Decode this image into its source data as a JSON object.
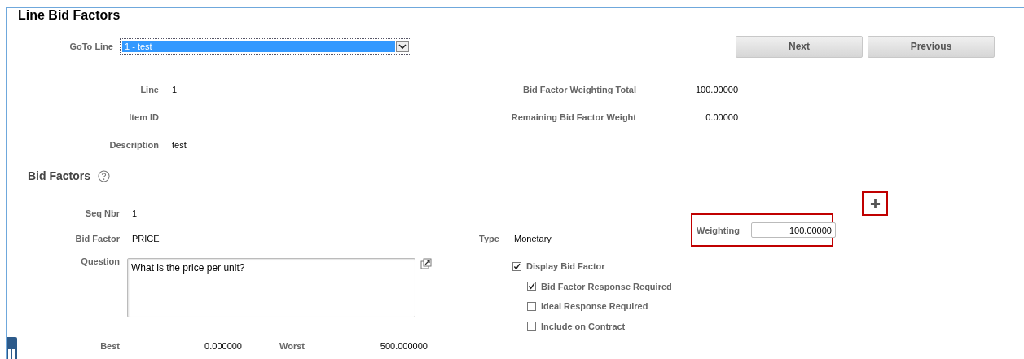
{
  "title": "Line Bid Factors",
  "goto": {
    "label": "GoTo Line",
    "value": "1 - test"
  },
  "buttons": [
    "Next",
    "Previous"
  ],
  "line_info": [
    {
      "label": "Line",
      "value": "1"
    },
    {
      "label": "Item ID"
    },
    {
      "label": "Description",
      "value": "test"
    }
  ],
  "totals": [
    {
      "label": "Bid Factor Weighting Total",
      "value": "100.00000"
    },
    {
      "label": "Remaining Bid Factor Weight",
      "value": "0.00000"
    }
  ],
  "bid_factors": {
    "heading": "Bid Factors",
    "seq_nbr": {
      "label": "Seq Nbr",
      "value": "1"
    },
    "bid_factor": {
      "label": "Bid Factor",
      "value": "PRICE"
    },
    "type": {
      "label": "Type",
      "value": "Monetary"
    },
    "weighting": {
      "label": "Weighting",
      "value": "100.00000"
    },
    "question": {
      "label": "Question",
      "value": "What is the price per unit?"
    },
    "checkboxes": [
      {
        "label": "Display Bid Factor",
        "checked": true,
        "children": [
          {
            "label": "Bid Factor Response Required",
            "checked": true
          },
          {
            "label": "Ideal Response Required",
            "checked": false
          },
          {
            "label": "Include on Contract",
            "checked": false
          }
        ]
      }
    ],
    "best": {
      "label": "Best",
      "value": "0.000000"
    },
    "worst": {
      "label": "Worst",
      "value": "500.000000"
    }
  }
}
